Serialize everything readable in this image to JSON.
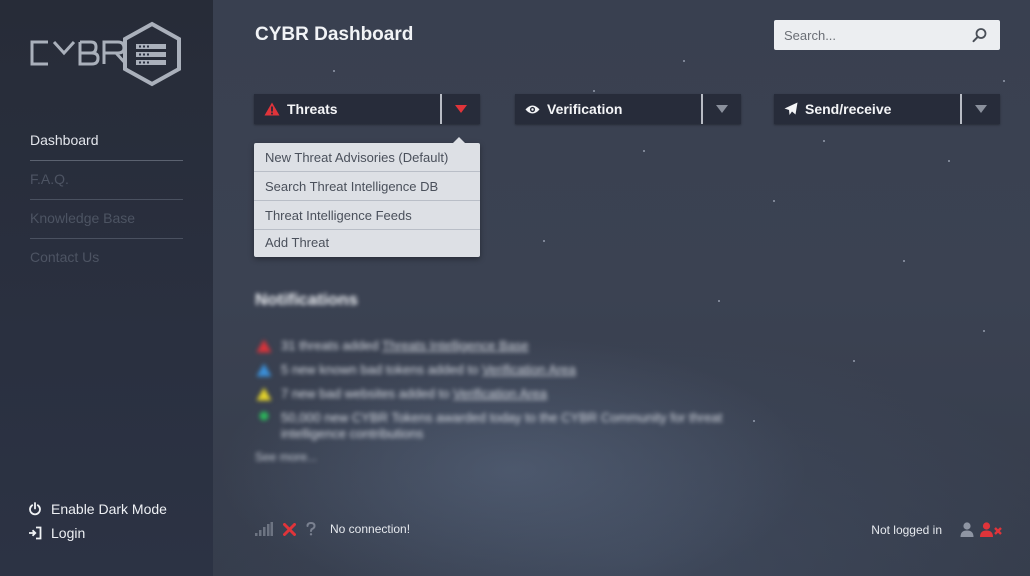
{
  "logo": {
    "text": "CYBR",
    "icon": "cybr-hexagon-logo"
  },
  "sidebar": {
    "items": [
      {
        "label": "Dashboard",
        "active": true
      },
      {
        "label": "F.A.Q.",
        "active": false
      },
      {
        "label": "Knowledge Base",
        "active": false
      },
      {
        "label": "Contact Us",
        "active": false
      }
    ],
    "dark_mode": {
      "label": "Enable Dark Mode",
      "icon": "power-icon"
    },
    "login": {
      "label": "Login",
      "icon": "sign-in-icon"
    }
  },
  "header": {
    "title": "CYBR Dashboard",
    "search_placeholder": "Search...",
    "search_icon": "search-icon"
  },
  "toolbar": {
    "threats": {
      "label": "Threats",
      "icon": "warning-icon",
      "icon_color": "#e0343a",
      "caret_color": "#e0343a"
    },
    "verification": {
      "label": "Verification",
      "icon": "eye-icon",
      "caret_color": "#8a909c"
    },
    "send_receive": {
      "label": "Send/receive",
      "icon": "paper-plane-icon",
      "caret_color": "#8a909c"
    }
  },
  "threats_menu": {
    "items": [
      "New Threat Advisories (Default)",
      "Search Threat Intelligence DB",
      "Threat Intelligence Feeds",
      "Add Threat"
    ]
  },
  "notifications": {
    "title": "Notifications",
    "items": [
      {
        "text": "31 threats added ",
        "link": "Threats Intelligence Base",
        "marker_color": "#d8333a"
      },
      {
        "text": "5 new known bad tokens added to ",
        "link": "Verification Area",
        "marker_color": "#3a8fd8"
      },
      {
        "text": "7 new bad websites added to ",
        "link": "Verification Area",
        "marker_color": "#e3d22a"
      },
      {
        "text": "50,000 new CYBR Tokens awarded today to the CYBR Community for threat intelligence contributions",
        "link": "",
        "marker_color": "#2bb35a"
      }
    ],
    "see_more": "See more..."
  },
  "status": {
    "connection_text": "No connection!",
    "login_text": "Not logged in"
  }
}
